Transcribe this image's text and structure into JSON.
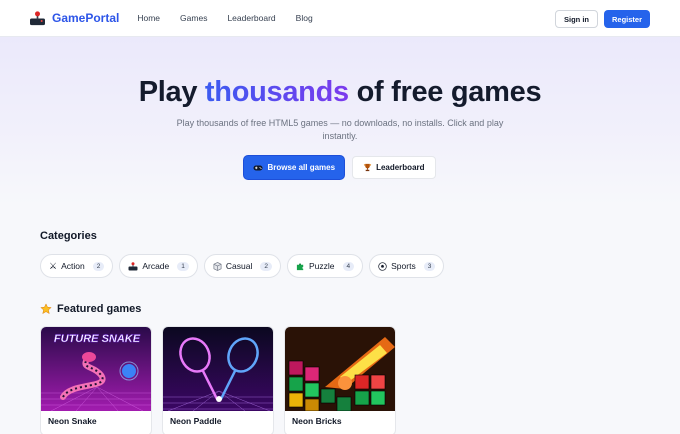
{
  "nav": {
    "brand": "GamePortal",
    "links": [
      "Home",
      "Games",
      "Leaderboard",
      "Blog"
    ],
    "sign_in": "Sign in",
    "register": "Register"
  },
  "hero": {
    "title_start": "Play ",
    "title_accent": "thousands",
    "title_end": " of free games",
    "subtitle": "Play thousands of free HTML5 games — no downloads, no installs. Click and play instantly.",
    "browse_label": "Browse all games",
    "leaderboard_label": "Leaderboard"
  },
  "categories": {
    "title": "Categories",
    "items": [
      {
        "label": "Action",
        "count": "2",
        "icon": "crossed-swords-icon"
      },
      {
        "label": "Arcade",
        "count": "1",
        "icon": "joystick-icon"
      },
      {
        "label": "Casual",
        "count": "2",
        "icon": "cube-icon"
      },
      {
        "label": "Puzzle",
        "count": "4",
        "icon": "puzzle-icon"
      },
      {
        "label": "Sports",
        "count": "3",
        "icon": "soccer-ball-icon"
      }
    ]
  },
  "featured": {
    "title": "Featured games",
    "games": [
      {
        "name": "Neon Snake",
        "thumb_text": "FUTURE SNAKE"
      },
      {
        "name": "Neon Paddle"
      },
      {
        "name": "Neon Bricks"
      }
    ]
  },
  "colors": {
    "brand": "#2d55e8",
    "primary": "#2563eb",
    "accent_gradient": [
      "#3b5bf0",
      "#7c3aed"
    ]
  }
}
